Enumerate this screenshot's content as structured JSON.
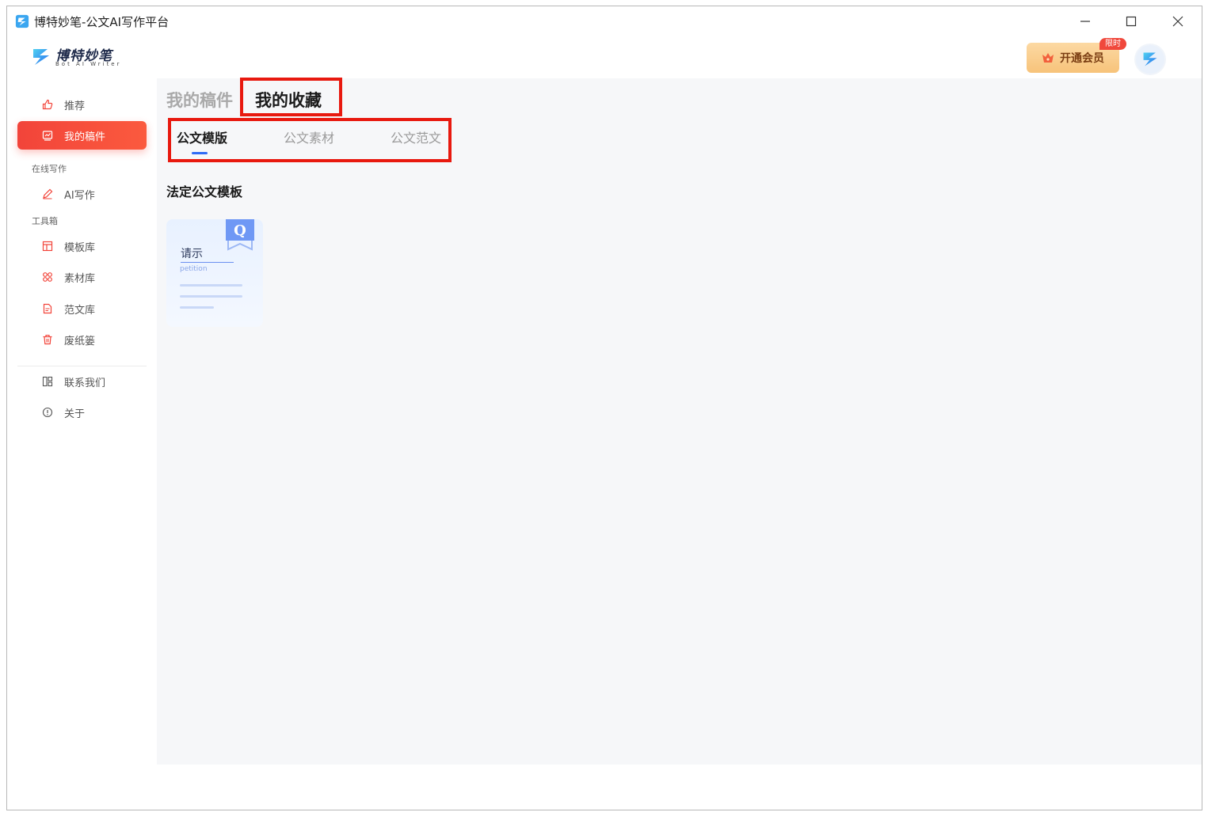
{
  "window": {
    "title": "博特妙笔-公文AI写作平台"
  },
  "header": {
    "logo_text": "博特妙笔",
    "logo_sub": "Bot AI Writer",
    "vip_label": "开通会员",
    "vip_badge": "限时"
  },
  "sidebar": {
    "items": {
      "recommend": "推荐",
      "my_drafts": "我的稿件",
      "ai_writing": "AI写作",
      "templates": "模板库",
      "materials": "素材库",
      "samples": "范文库",
      "trash": "废纸篓",
      "contact": "联系我们",
      "about": "关于"
    },
    "section_online": "在线写作",
    "section_tools": "工具箱"
  },
  "main": {
    "tabs": {
      "drafts": "我的稿件",
      "favorites": "我的收藏"
    },
    "subtabs": {
      "template": "公文模版",
      "material": "公文素材",
      "sample": "公文范文"
    },
    "section_title": "法定公文模板",
    "card": {
      "title": "请示",
      "subtitle": "petition",
      "badge_letter": "Q"
    }
  },
  "colors": {
    "accent_red": "#f2443a",
    "highlight_box": "#e8190f",
    "active_tab_underline": "#2f6bf5",
    "vip_gold": "#f7c37a"
  }
}
